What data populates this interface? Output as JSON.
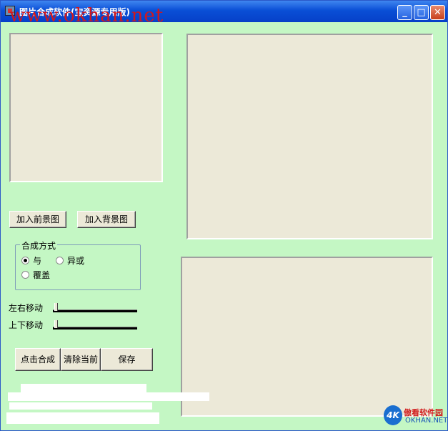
{
  "window": {
    "title": "图片合成软件(宝资源专用版)",
    "watermark": "www.okhan.net",
    "minimize_label": "_",
    "maximize_label": "□",
    "close_label": "✕"
  },
  "buttons": {
    "add_foreground": "加入前景图",
    "add_background": "加入背景图",
    "compose": "点击合成",
    "clear": "清除当前",
    "save": "保存"
  },
  "blend_mode": {
    "group_label": "合成方式",
    "options": [
      "与",
      "异或",
      "覆盖"
    ],
    "selected": "与"
  },
  "sliders": {
    "horizontal_label": "左右移动",
    "vertical_label": "上下移动",
    "horizontal_value": 0,
    "vertical_value": 0
  },
  "logo": {
    "mark": "4K",
    "name_cn": "傲看软件园",
    "name_en": "OKHAN.NET"
  },
  "colors": {
    "window_bg": "#c4f7c4",
    "panel_bg": "#ece9d8",
    "title_blue": "#0a4fd6",
    "watermark_red": "#d0181e"
  }
}
